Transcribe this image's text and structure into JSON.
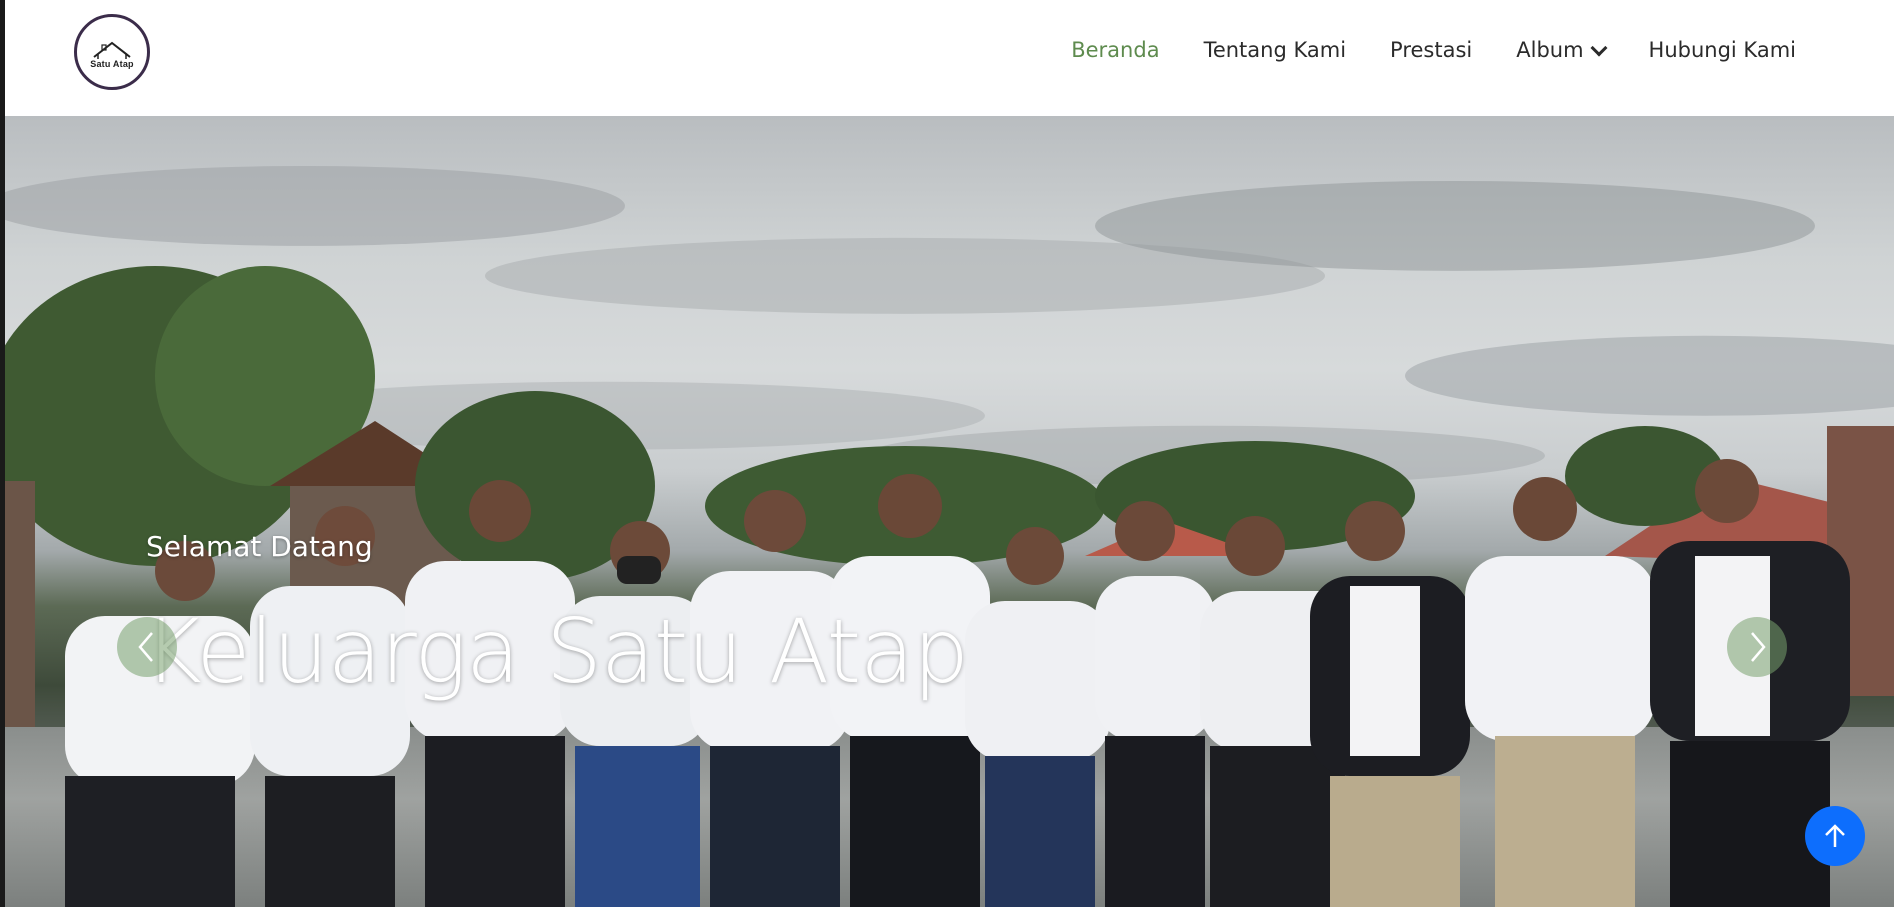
{
  "brand": {
    "logo_text": "Satu Atap"
  },
  "nav": {
    "items": [
      {
        "label": "Beranda",
        "active": true
      },
      {
        "label": "Tentang Kami",
        "active": false
      },
      {
        "label": "Prestasi",
        "active": false
      },
      {
        "label": "Album",
        "active": false,
        "dropdown": true
      },
      {
        "label": "Hubungi Kami",
        "active": false
      }
    ]
  },
  "hero": {
    "subtitle": "Selamat Datang",
    "title": "Keluarga Satu Atap",
    "prev_icon": "chevron-left-icon",
    "next_icon": "chevron-right-icon"
  },
  "scroll_top": {
    "icon": "arrow-up-icon"
  },
  "colors": {
    "active_nav": "#5e8b4e",
    "nav_text": "#2b2b2b",
    "scroll_top": "#0d6efd",
    "carousel_button": "#78a06e"
  }
}
